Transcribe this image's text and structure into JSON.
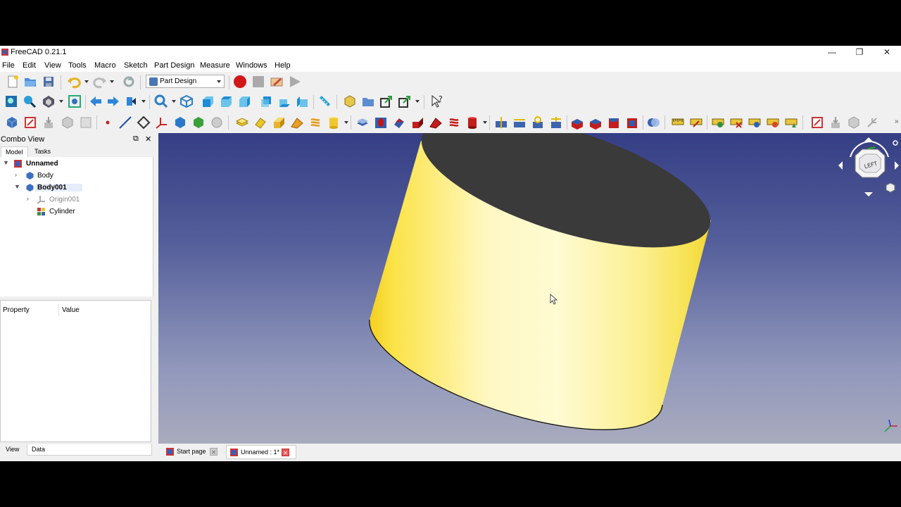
{
  "window": {
    "title": "FreeCAD 0.21.1",
    "minimize": "—",
    "maximize": "❐",
    "close": "✕"
  },
  "menu": [
    "File",
    "Edit",
    "View",
    "Tools",
    "Macro",
    "Sketch",
    "Part Design",
    "Measure",
    "Windows",
    "Help"
  ],
  "toolbar": {
    "workbench": "Part Design"
  },
  "combo": {
    "title": "Combo View",
    "float_btn": "⧉",
    "close_btn": "✕",
    "tabs": [
      "Model",
      "Tasks"
    ],
    "tree": {
      "root": "Unnamed",
      "body1": "Body",
      "body2": "Body001",
      "origin": "Origin001",
      "cylinder": "Cylinder"
    },
    "props": {
      "col_property": "Property",
      "col_value": "Value"
    },
    "bottom_tabs": [
      "View",
      "Data"
    ]
  },
  "navcube": {
    "face": "LEFT"
  },
  "doc_tabs": [
    "Start page",
    "Unnamed : 1*"
  ],
  "colors": {
    "accent_yellow": "#f5e74a",
    "viewport_top": "#353e84",
    "viewport_bottom": "#a9abbd",
    "record_red": "#d01818"
  }
}
